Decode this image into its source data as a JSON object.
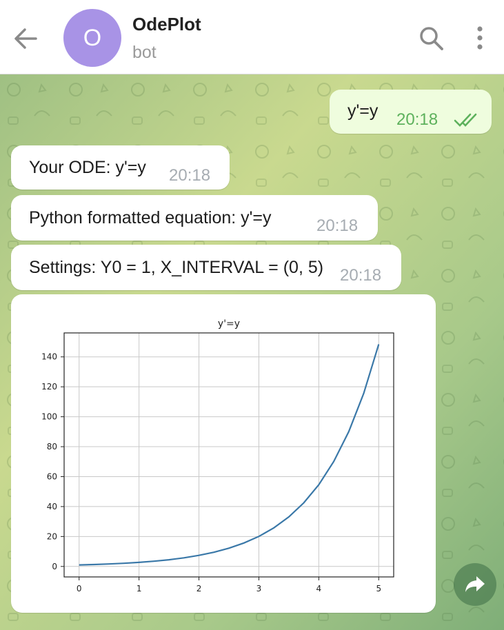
{
  "header": {
    "title": "OdePlot",
    "subtitle": "bot",
    "avatar_letter": "O",
    "avatar_color": "#a893e6"
  },
  "messages": [
    {
      "direction": "out",
      "text": "y'=y",
      "time": "20:18",
      "status": "read"
    },
    {
      "direction": "in",
      "text": "Your ODE: y'=y",
      "time": "20:18"
    },
    {
      "direction": "in",
      "text": "Python formatted equation: y'=y",
      "time": "20:18"
    },
    {
      "direction": "in",
      "text": "Settings: Y0 = 1, X_INTERVAL = (0, 5)",
      "time": "20:18"
    }
  ],
  "colors": {
    "accent_green": "#5db15c",
    "line_color": "#3a78a8",
    "wallpaper_top": "#c8d88e",
    "wallpaper_bottom": "#7fae78"
  },
  "icons": [
    "back-arrow-icon",
    "search-icon",
    "more-vert-icon",
    "double-check-icon",
    "share-icon"
  ],
  "chart_data": {
    "type": "line",
    "title": "y'=y",
    "xlabel": "",
    "ylabel": "",
    "xlim": [
      -0.25,
      5.25
    ],
    "ylim": [
      -7,
      156
    ],
    "xticks": [
      0,
      1,
      2,
      3,
      4,
      5
    ],
    "yticks": [
      0,
      20,
      40,
      60,
      80,
      100,
      120,
      140
    ],
    "grid": true,
    "series": [
      {
        "x": [
          0,
          0.25,
          0.5,
          0.75,
          1,
          1.25,
          1.5,
          1.75,
          2,
          2.25,
          2.5,
          2.75,
          3,
          3.25,
          3.5,
          3.75,
          4,
          4.25,
          4.5,
          4.75,
          5
        ],
        "values": [
          1,
          1.28,
          1.65,
          2.12,
          2.72,
          3.49,
          4.48,
          5.75,
          7.39,
          9.49,
          12.18,
          15.64,
          20.09,
          25.79,
          33.12,
          42.52,
          54.6,
          70.11,
          90.02,
          115.58,
          148.41
        ]
      }
    ]
  }
}
